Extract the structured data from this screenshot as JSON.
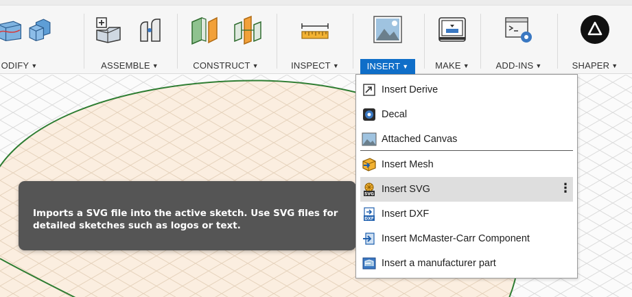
{
  "toolbar": {
    "groups": [
      {
        "label": "ODIFY",
        "caret": "▼"
      },
      {
        "label": "ASSEMBLE",
        "caret": "▼"
      },
      {
        "label": "CONSTRUCT",
        "caret": "▼"
      },
      {
        "label": "INSPECT",
        "caret": "▼"
      },
      {
        "label": "INSERT",
        "caret": "▼",
        "active": true
      },
      {
        "label": "MAKE",
        "caret": "▼"
      },
      {
        "label": "ADD-INS",
        "caret": "▼"
      },
      {
        "label": "SHAPER",
        "caret": "▼"
      }
    ],
    "accent_color": "#0f6ec8"
  },
  "insert_menu": {
    "items": [
      {
        "label": "Insert Derive",
        "icon": "insert-derive-icon"
      },
      {
        "label": "Decal",
        "icon": "decal-icon"
      },
      {
        "label": "Attached Canvas",
        "icon": "attached-canvas-icon"
      },
      {
        "label": "Insert Mesh",
        "icon": "insert-mesh-icon"
      },
      {
        "label": "Insert SVG",
        "icon": "insert-svg-icon",
        "highlighted": true,
        "more": "⋮"
      },
      {
        "label": "Insert DXF",
        "icon": "insert-dxf-icon"
      },
      {
        "label": "Insert McMaster-Carr Component",
        "icon": "mcmaster-carr-icon"
      },
      {
        "label": "Insert a manufacturer part",
        "icon": "manufacturer-part-icon"
      }
    ]
  },
  "tooltip": {
    "text": "Imports a SVG file into the active sketch. Use SVG files for detailed sketches such as logos or text."
  }
}
